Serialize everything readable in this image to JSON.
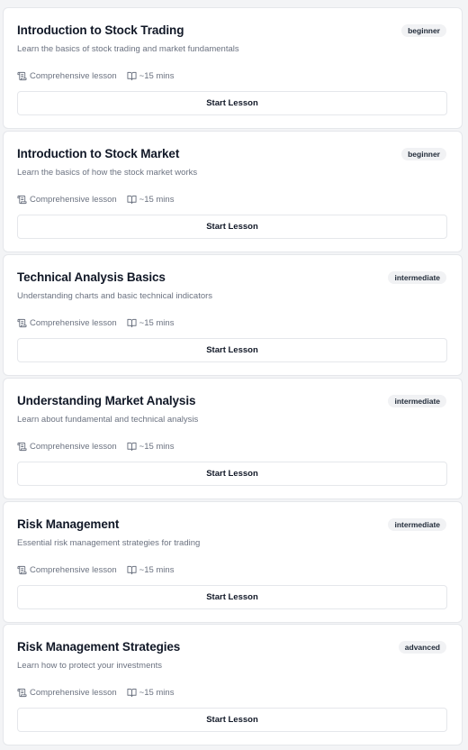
{
  "lessons": [
    {
      "title": "Introduction to Stock Trading",
      "level": "beginner",
      "description": "Learn the basics of stock trading and market fundamentals",
      "type_label": "Comprehensive lesson",
      "duration_label": "~15 mins",
      "button_label": "Start Lesson"
    },
    {
      "title": "Introduction to Stock Market",
      "level": "beginner",
      "description": "Learn the basics of how the stock market works",
      "type_label": "Comprehensive lesson",
      "duration_label": "~15 mins",
      "button_label": "Start Lesson"
    },
    {
      "title": "Technical Analysis Basics",
      "level": "intermediate",
      "description": "Understanding charts and basic technical indicators",
      "type_label": "Comprehensive lesson",
      "duration_label": "~15 mins",
      "button_label": "Start Lesson"
    },
    {
      "title": "Understanding Market Analysis",
      "level": "intermediate",
      "description": "Learn about fundamental and technical analysis",
      "type_label": "Comprehensive lesson",
      "duration_label": "~15 mins",
      "button_label": "Start Lesson"
    },
    {
      "title": "Risk Management",
      "level": "intermediate",
      "description": "Essential risk management strategies for trading",
      "type_label": "Comprehensive lesson",
      "duration_label": "~15 mins",
      "button_label": "Start Lesson"
    },
    {
      "title": "Risk Management Strategies",
      "level": "advanced",
      "description": "Learn how to protect your investments",
      "type_label": "Comprehensive lesson",
      "duration_label": "~15 mins",
      "button_label": "Start Lesson"
    }
  ],
  "icons": {
    "type_icon": "scroll-icon",
    "duration_icon": "book-open-icon"
  },
  "colors": {
    "card_background": "#ffffff",
    "card_border": "#e5e7eb",
    "page_background": "#f3f4f6",
    "badge_background": "#f1f2f4",
    "muted_text": "#6b7280"
  }
}
